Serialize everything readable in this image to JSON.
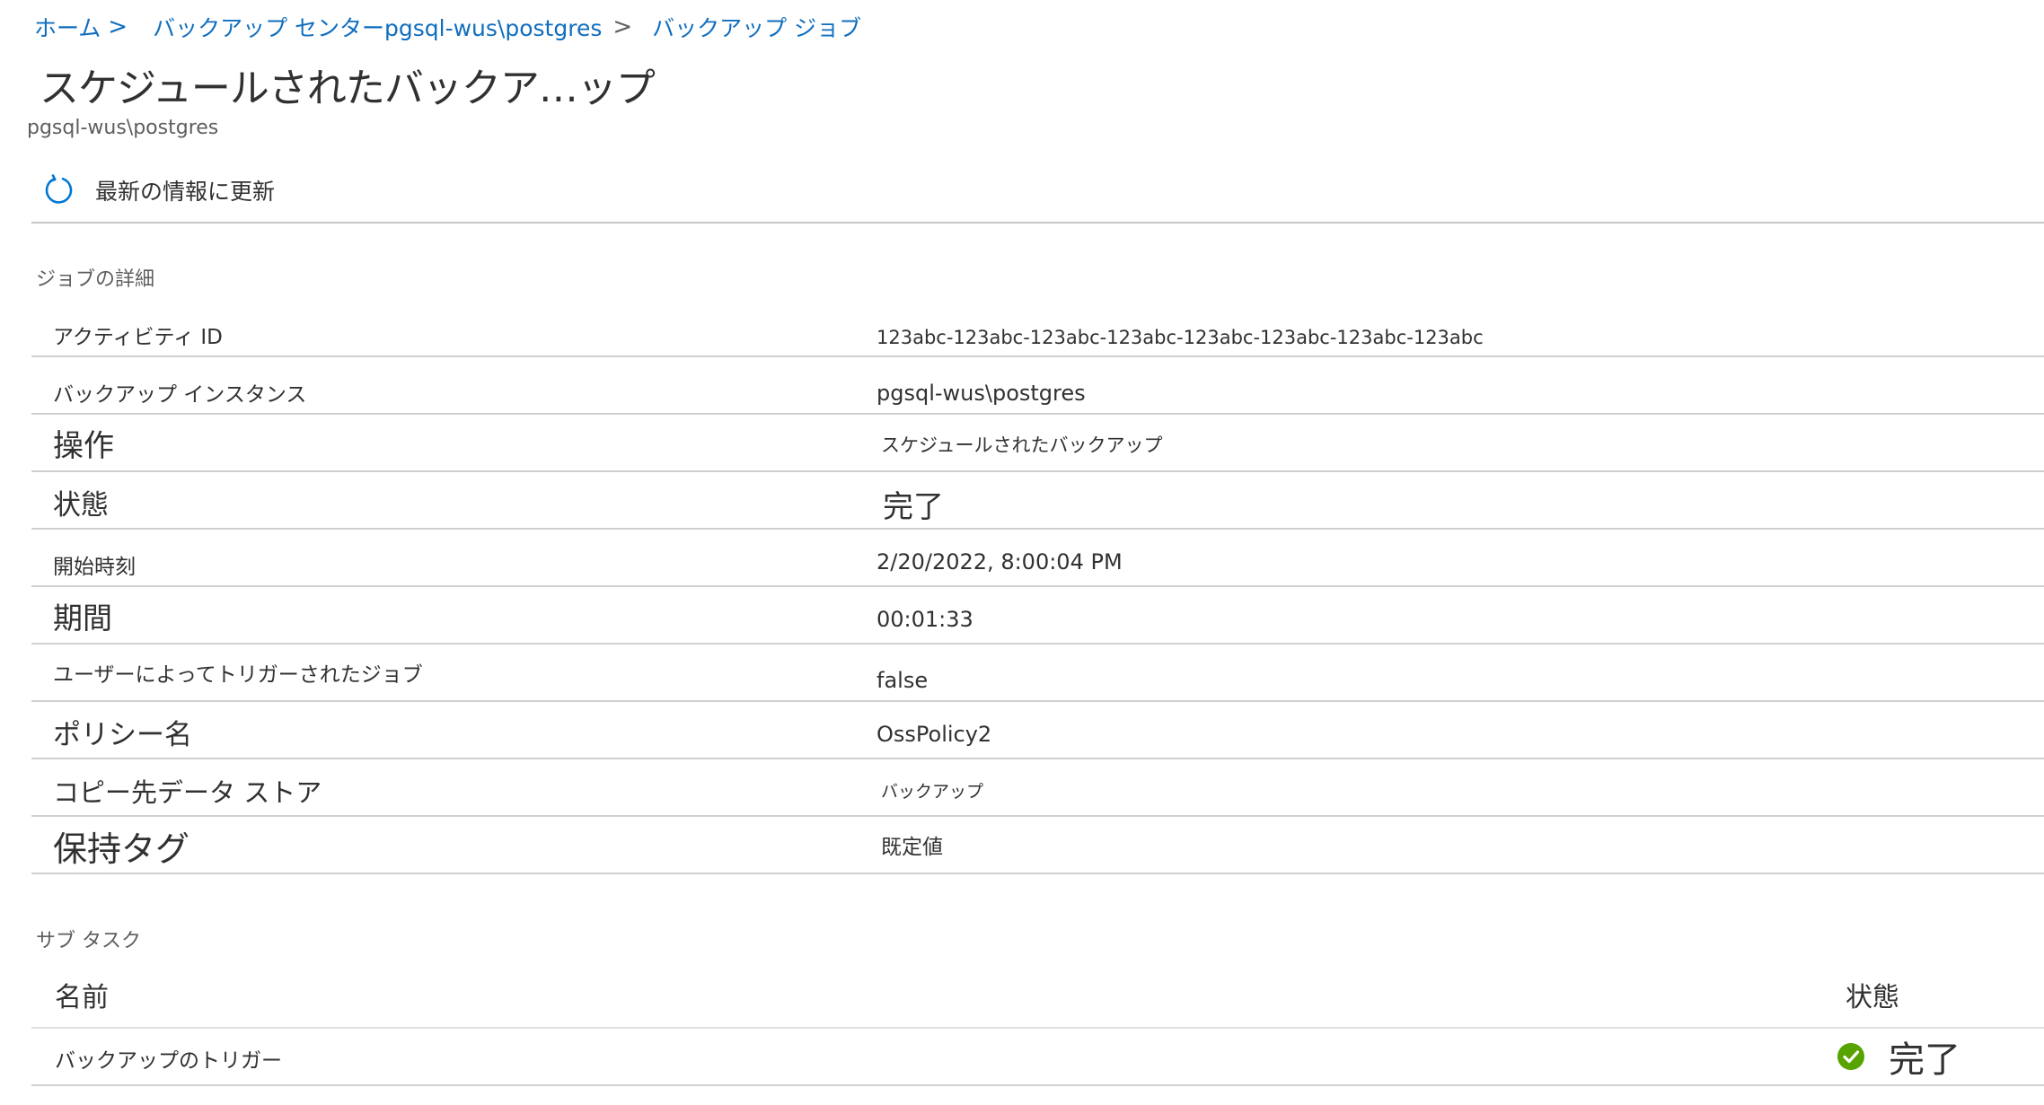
{
  "breadcrumb": {
    "home": "ホーム",
    "sep1": ">",
    "backup_center": "バックアップ センターpgsql-wus\\postgres",
    "sep2": ">",
    "backup_jobs": "バックアップ ジョブ"
  },
  "page": {
    "title": "スケジュールされたバックア…ップ",
    "subtitle": "pgsql-wus\\postgres"
  },
  "toolbar": {
    "refresh_label": "最新の情報に更新",
    "refresh_icon": "refresh-icon"
  },
  "job_details": {
    "heading": "ジョブの詳細",
    "rows": [
      {
        "key": "アクティビティ ID",
        "value": "123abc-123abc-123abc-123abc-123abc-123abc-123abc-123abc"
      },
      {
        "key": "バックアップ インスタンス",
        "value": "pgsql-wus\\postgres"
      },
      {
        "key": "操作",
        "value": "スケジュールされたバックアップ"
      },
      {
        "key": "状態",
        "value": "完了"
      },
      {
        "key": "開始時刻",
        "value": "2/20/2022, 8:00:04 PM"
      },
      {
        "key": "期間",
        "value": "00:01:33"
      },
      {
        "key": "ユーザーによってトリガーされたジョブ",
        "value": "false"
      },
      {
        "key": "ポリシー名",
        "value": "OssPolicy2"
      },
      {
        "key": "コピー先データ ストア",
        "value": "バックアップ"
      },
      {
        "key": "保持タグ",
        "value": "既定値"
      }
    ]
  },
  "subtasks": {
    "heading": "サブ タスク",
    "columns": {
      "name": "名前",
      "status": "状態"
    },
    "rows": [
      {
        "name": "バックアップのトリガー",
        "status": "完了",
        "status_icon": "check-circle-icon",
        "status_color": "#57a300"
      }
    ]
  },
  "colors": {
    "link": "#106ebe",
    "refresh_icon": "#0078d4",
    "success": "#57a300"
  }
}
